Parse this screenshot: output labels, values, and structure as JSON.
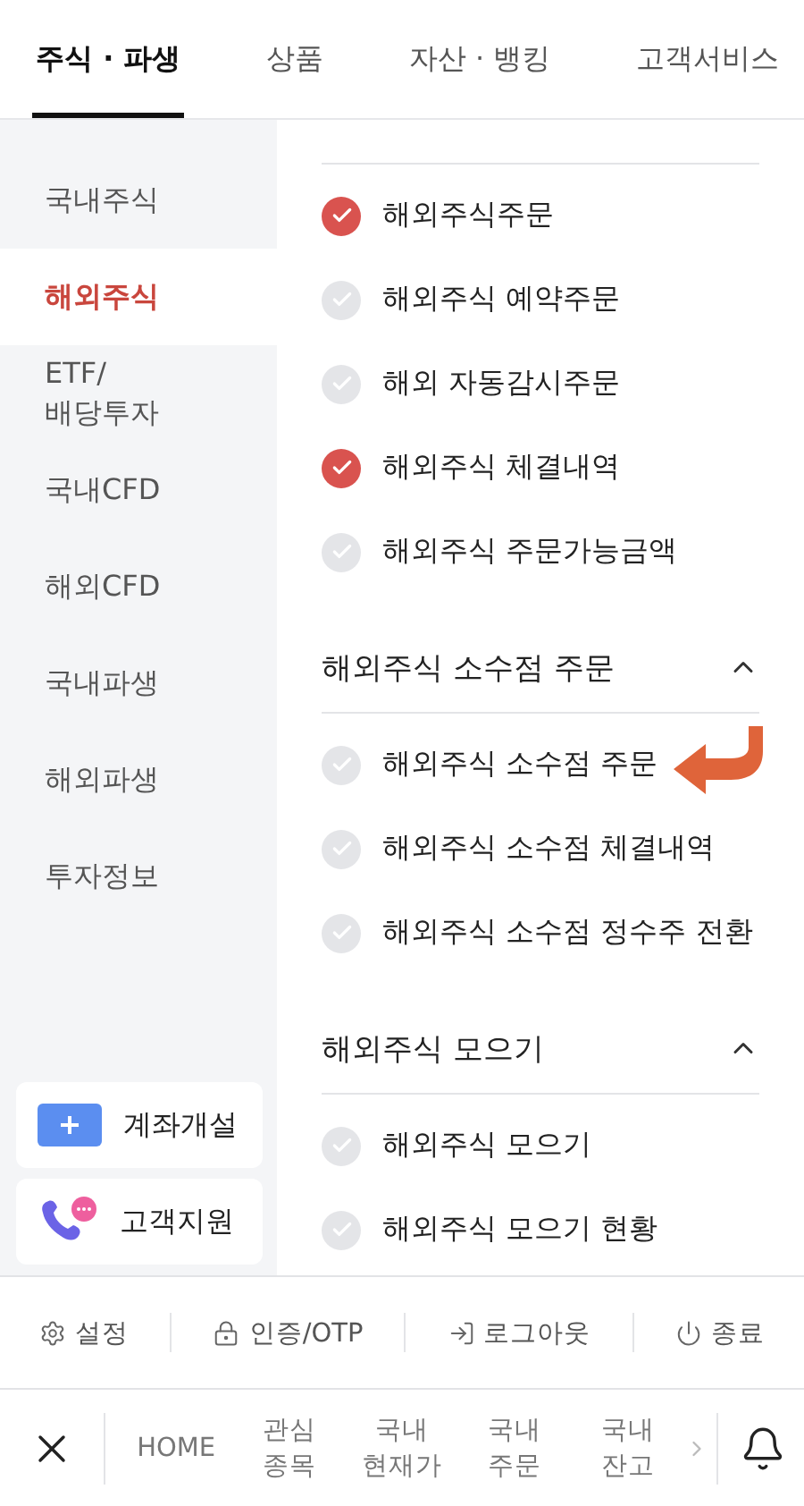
{
  "tabs": [
    {
      "label": "주식 · 파생",
      "selected": true
    },
    {
      "label": "상품",
      "selected": false
    },
    {
      "label": "자산 · 뱅킹",
      "selected": false
    },
    {
      "label": "고객서비스",
      "selected": false
    }
  ],
  "sidebar": {
    "items": [
      {
        "label": "국내주식",
        "selected": false
      },
      {
        "label": "해외주식",
        "selected": true
      },
      {
        "label": "ETF/\n배당투자",
        "selected": false
      },
      {
        "label": "국내CFD",
        "selected": false
      },
      {
        "label": "해외CFD",
        "selected": false
      },
      {
        "label": "국내파생",
        "selected": false
      },
      {
        "label": "해외파생",
        "selected": false
      },
      {
        "label": "투자정보",
        "selected": false
      }
    ],
    "buttons": [
      {
        "kind": "account",
        "label": "계좌개설"
      },
      {
        "kind": "support",
        "label": "고객지원"
      }
    ]
  },
  "sections": [
    {
      "items": [
        {
          "label": "해외주식주문",
          "checked": true
        },
        {
          "label": "해외주식 예약주문",
          "checked": false
        },
        {
          "label": "해외 자동감시주문",
          "checked": false
        },
        {
          "label": "해외주식 체결내역",
          "checked": true
        },
        {
          "label": "해외주식 주문가능금액",
          "checked": false
        }
      ]
    },
    {
      "title": "해외주식 소수점 주문",
      "expanded": true,
      "items": [
        {
          "label": "해외주식 소수점 주문",
          "checked": false,
          "pointer": true
        },
        {
          "label": "해외주식 소수점 체결내역",
          "checked": false
        },
        {
          "label": "해외주식 소수점 정수주 전환",
          "checked": false
        }
      ]
    },
    {
      "title": "해외주식 모으기",
      "expanded": true,
      "items": [
        {
          "label": "해외주식 모으기",
          "checked": false
        },
        {
          "label": "해외주식 모으기 현황",
          "checked": false
        }
      ]
    }
  ],
  "utility_bar": [
    {
      "kind": "settings",
      "label": "설정"
    },
    {
      "kind": "lock",
      "label": "인증/OTP"
    },
    {
      "kind": "logout",
      "label": "로그아웃"
    },
    {
      "kind": "power",
      "label": "종료"
    }
  ],
  "bottom_nav": {
    "items": [
      "HOME",
      "관심\n종목",
      "국내\n현재가",
      "국내\n주문",
      "국내\n잔고"
    ]
  }
}
